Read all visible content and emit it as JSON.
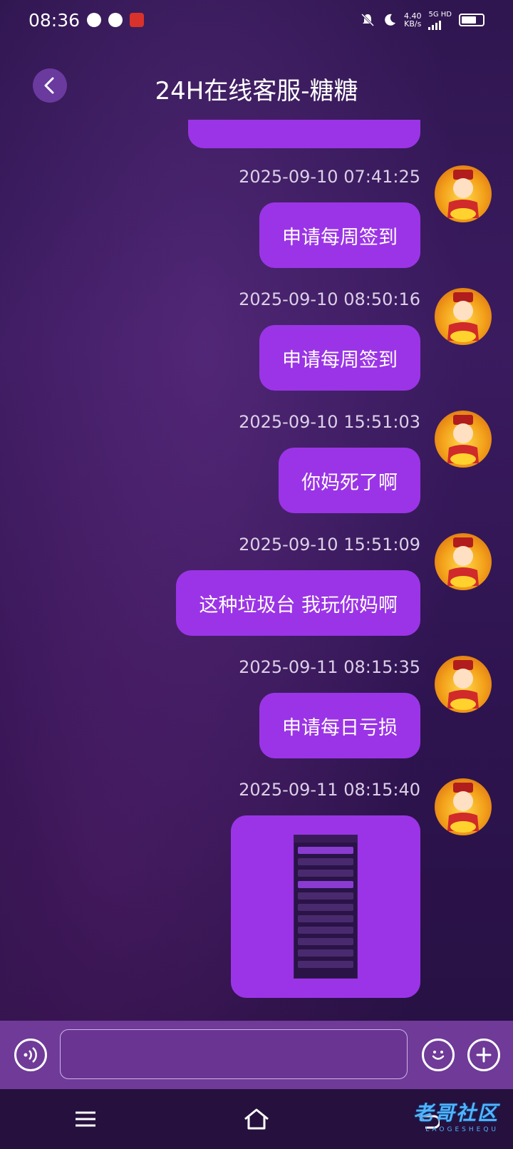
{
  "status": {
    "time": "08:36",
    "speed_value": "4.40",
    "speed_unit": "KB/s",
    "network": "5G HD"
  },
  "header": {
    "title": "24H在线客服-糖糖"
  },
  "messages": [
    {
      "time": "2025-09-10 07:41:25",
      "text": "申请每周签到"
    },
    {
      "time": "2025-09-10 08:50:16",
      "text": "申请每周签到"
    },
    {
      "time": "2025-09-10 15:51:03",
      "text": "你妈死了啊"
    },
    {
      "time": "2025-09-10 15:51:09",
      "text": "这种垃圾台 我玩你妈啊"
    },
    {
      "time": "2025-09-11 08:15:35",
      "text": "申请每日亏损"
    },
    {
      "time": "2025-09-11 08:15:40",
      "text": ""
    }
  ],
  "watermark": {
    "main": "老哥社区",
    "sub": "LAOGESHEQU"
  },
  "colors": {
    "bubble": "#9b34e6",
    "input_bar": "#6f3a98",
    "back_button": "#6b3a9e"
  }
}
